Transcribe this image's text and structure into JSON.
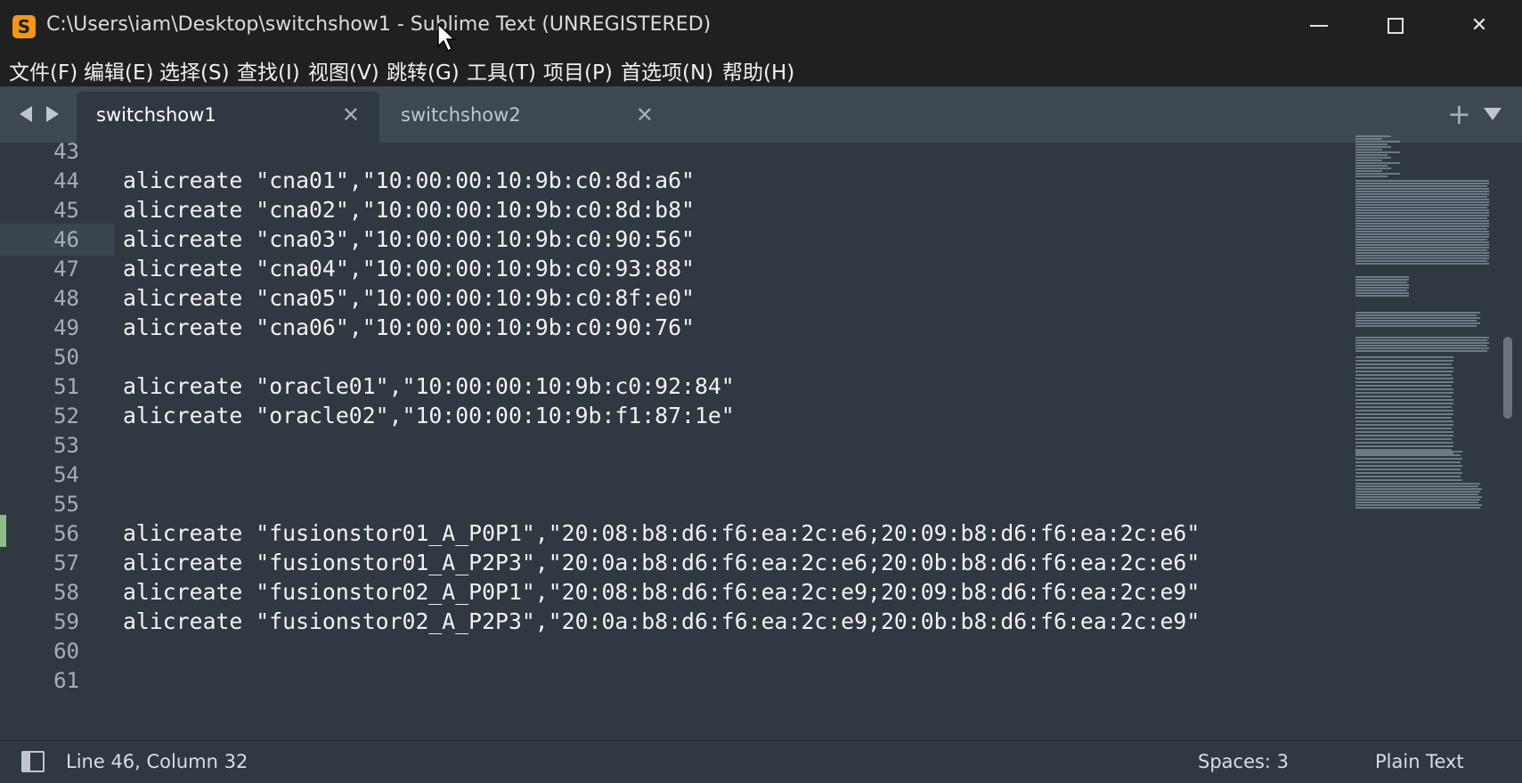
{
  "window": {
    "title": "C:\\Users\\iam\\Desktop\\switchshow1 - Sublime Text (UNREGISTERED)",
    "app_icon_glyph": "S",
    "minimize_label": "",
    "close_label": "✕"
  },
  "menu": [
    "文件(F)",
    "编辑(E)",
    "选择(S)",
    "查找(I)",
    "视图(V)",
    "跳转(G)",
    "工具(T)",
    "项目(P)",
    "首选项(N)",
    "帮助(H)"
  ],
  "tabs": [
    {
      "label": "switchshow1",
      "active": true,
      "close": "✕"
    },
    {
      "label": "switchshow2",
      "active": false,
      "close": "✕"
    }
  ],
  "tabbar": {
    "plus": "+"
  },
  "editor": {
    "current_line": "46",
    "lines": [
      {
        "num": "43",
        "text": ""
      },
      {
        "num": "44",
        "text": "alicreate \"cna01\",\"10:00:00:10:9b:c0:8d:a6\""
      },
      {
        "num": "45",
        "text": "alicreate \"cna02\",\"10:00:00:10:9b:c0:8d:b8\""
      },
      {
        "num": "46",
        "text": "alicreate \"cna03\",\"10:00:00:10:9b:c0:90:56\""
      },
      {
        "num": "47",
        "text": "alicreate \"cna04\",\"10:00:00:10:9b:c0:93:88\""
      },
      {
        "num": "48",
        "text": "alicreate \"cna05\",\"10:00:00:10:9b:c0:8f:e0\""
      },
      {
        "num": "49",
        "text": "alicreate \"cna06\",\"10:00:00:10:9b:c0:90:76\""
      },
      {
        "num": "50",
        "text": ""
      },
      {
        "num": "51",
        "text": "alicreate \"oracle01\",\"10:00:00:10:9b:c0:92:84\""
      },
      {
        "num": "52",
        "text": "alicreate \"oracle02\",\"10:00:00:10:9b:f1:87:1e\""
      },
      {
        "num": "53",
        "text": ""
      },
      {
        "num": "54",
        "text": ""
      },
      {
        "num": "55",
        "text": ""
      },
      {
        "num": "56",
        "text": "alicreate \"fusionstor01_A_P0P1\",\"20:08:b8:d6:f6:ea:2c:e6;20:09:b8:d6:f6:ea:2c:e6\""
      },
      {
        "num": "57",
        "text": "alicreate \"fusionstor01_A_P2P3\",\"20:0a:b8:d6:f6:ea:2c:e6;20:0b:b8:d6:f6:ea:2c:e6\""
      },
      {
        "num": "58",
        "text": "alicreate \"fusionstor02_A_P0P1\",\"20:08:b8:d6:f6:ea:2c:e9;20:09:b8:d6:f6:ea:2c:e9\""
      },
      {
        "num": "59",
        "text": "alicreate \"fusionstor02_A_P2P3\",\"20:0a:b8:d6:f6:ea:2c:e9;20:0b:b8:d6:f6:ea:2c:e9\""
      },
      {
        "num": "60",
        "text": ""
      },
      {
        "num": "61",
        "text": ""
      }
    ]
  },
  "status": {
    "position": "Line 46, Column 32",
    "spaces": "Spaces: 3",
    "syntax": "Plain Text"
  },
  "colors": {
    "editor_bg": "#303841",
    "titlebar_bg": "#202020",
    "tabbar_bg": "#3e4852",
    "accent_icon": "#f29718"
  }
}
